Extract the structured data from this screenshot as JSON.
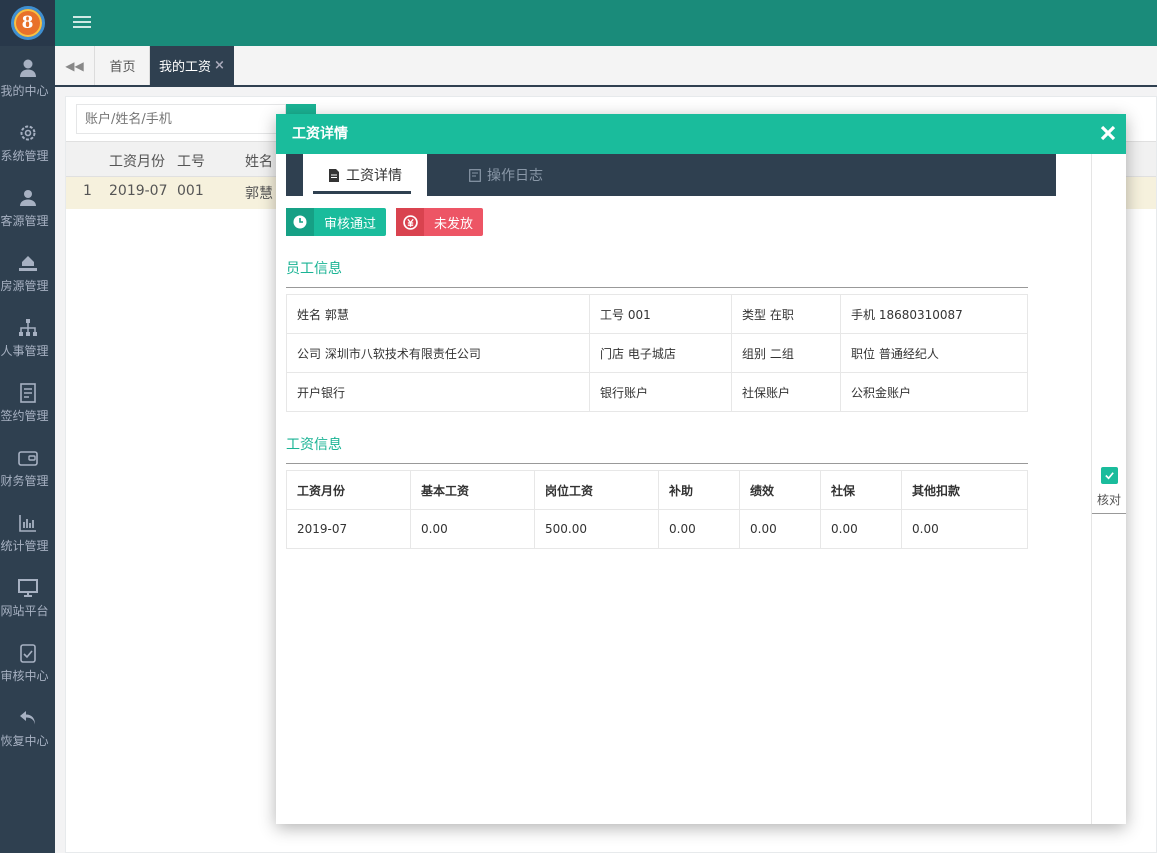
{
  "sidebar": {
    "logo_text": "8",
    "items": [
      {
        "label": "我的中心",
        "icon": "user-icon"
      },
      {
        "label": "系统管理",
        "icon": "gear-icon"
      },
      {
        "label": "客源管理",
        "icon": "users-icon"
      },
      {
        "label": "房源管理",
        "icon": "house-hand-icon"
      },
      {
        "label": "人事管理",
        "icon": "org-chart-icon"
      },
      {
        "label": "签约管理",
        "icon": "contract-icon"
      },
      {
        "label": "财务管理",
        "icon": "wallet-icon"
      },
      {
        "label": "统计管理",
        "icon": "bar-chart-icon"
      },
      {
        "label": "网站平台",
        "icon": "monitor-icon"
      },
      {
        "label": "审核中心",
        "icon": "check-doc-icon"
      },
      {
        "label": "恢复中心",
        "icon": "undo-icon"
      }
    ]
  },
  "tabs": {
    "home": "首页",
    "active": "我的工资",
    "close": "×"
  },
  "background": {
    "search_placeholder": "账户/姓名/手机",
    "columns": [
      "工资月份",
      "工号",
      "姓名"
    ],
    "row": {
      "index": "1",
      "month": "2019-07",
      "id": "001",
      "name": "郭慧"
    }
  },
  "modal": {
    "title": "工资详情",
    "tabs": [
      "工资详情",
      "操作日志"
    ],
    "status": {
      "approved": "审核通过",
      "unpaid": "未发放"
    },
    "employee_section": "员工信息",
    "employee_rows": [
      [
        "姓名 郭慧",
        "工号 001",
        "类型 在职",
        "手机 18680310087"
      ],
      [
        "公司 深圳市八软技术有限责任公司",
        "门店 电子城店",
        "组别 二组",
        "职位 普通经纪人"
      ],
      [
        "开户银行",
        "银行账户",
        "社保账户",
        "公积金账户"
      ]
    ],
    "salary_section": "工资信息",
    "salary_headers": [
      "工资月份",
      "基本工资",
      "岗位工资",
      "补助",
      "绩效",
      "社保",
      "其他扣款"
    ],
    "salary_row": [
      "2019-07",
      "0.00",
      "500.00",
      "0.00",
      "0.00",
      "0.00",
      "0.00"
    ],
    "verify_label": "核对"
  },
  "colors": {
    "sidebar": "#2f4050",
    "topbar": "#1a8b7a",
    "accent": "#1abc9c",
    "danger": "#ed5565"
  }
}
